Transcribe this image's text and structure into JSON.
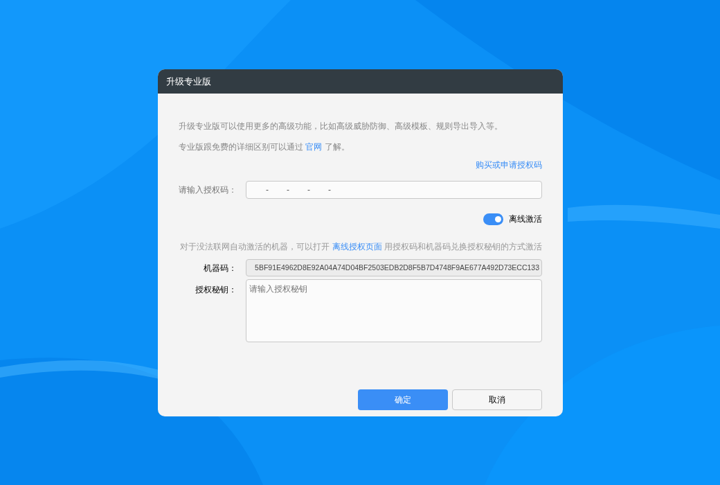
{
  "dialog": {
    "title": "升级专业版",
    "intro": "升级专业版可以使用更多的高级功能，比如高级威胁防御、高级模板、规则导出导入等。",
    "compare": {
      "before": "专业版跟免费的详细区别可以通过",
      "link": "官网",
      "after": "了解。"
    },
    "buy_link": "购买或申请授权码",
    "license_code": {
      "label": "请输入授权码：",
      "segments": [
        "-",
        "-",
        "-",
        "-"
      ]
    },
    "offline": {
      "label": "离线激活",
      "on": true
    },
    "offline_note": {
      "before": "对于没法联网自动激活的机器，可以打开",
      "link": "离线授权页面",
      "after": "用授权码和机器码兑换授权秘钥的方式激活"
    },
    "machine_code": {
      "label": "机器码：",
      "value": "5BF91E4962D8E92A04A74D04BF2503EDB2D8F5B7D4748F9AE677A492D73ECC133"
    },
    "secret_key": {
      "label": "授权秘钥：",
      "placeholder": "请输入授权秘钥"
    },
    "buttons": [
      {
        "label": "确定",
        "kind": "primary"
      },
      {
        "label": "取消",
        "kind": "secondary"
      }
    ]
  }
}
